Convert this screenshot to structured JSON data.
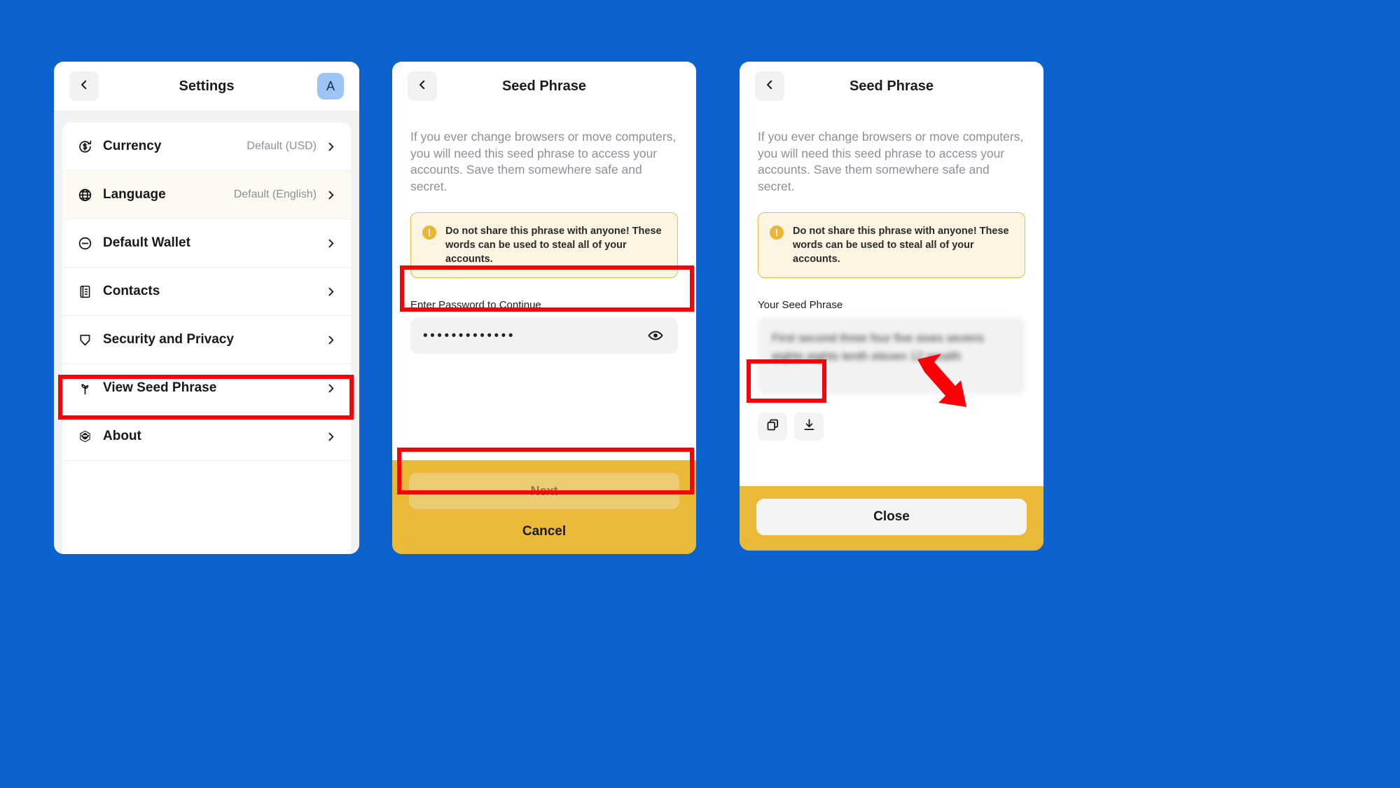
{
  "theme": {
    "background": "#0d63ce",
    "annotation": "#fb0007",
    "gold_footer": "#e9b937",
    "warning_bg": "#fdf5e2",
    "warning_border": "#e9bd4d",
    "warning_icon": "#eab63a",
    "avatar_bg": "#9cc5f5",
    "highlight_row": "#fdfaf2"
  },
  "settings_panel": {
    "title": "Settings",
    "back_icon": "chevron-left-icon",
    "avatar_initial": "A",
    "rows": [
      {
        "icon": "currency-dollar-icon",
        "label": "Currency",
        "value": "Default (USD)",
        "highlight": false
      },
      {
        "icon": "globe-icon",
        "label": "Language",
        "value": "Default (English)",
        "highlight": true
      },
      {
        "icon": "minus-circle-icon",
        "label": "Default Wallet",
        "value": "",
        "highlight": false
      },
      {
        "icon": "contacts-book-icon",
        "label": "Contacts",
        "value": "",
        "highlight": false
      },
      {
        "icon": "shield-icon",
        "label": "Security and Privacy",
        "value": "",
        "highlight": false
      },
      {
        "icon": "sprout-icon",
        "label": "View Seed Phrase",
        "value": "",
        "highlight": false
      },
      {
        "icon": "cube-icon",
        "label": "About",
        "value": "",
        "highlight": false
      }
    ]
  },
  "password_panel": {
    "title": "Seed Phrase",
    "back_icon": "chevron-left-icon",
    "description": "If you ever change browsers or move computers, you will need this seed phrase to access your accounts. Save them somewhere safe and secret.",
    "warning": {
      "icon": "exclamation-circle-icon",
      "glyph": "!",
      "text": "Do not share this phrase with anyone! These words can be used to steal all of your accounts."
    },
    "field_label": "Enter Password to Continue",
    "password_masked": "•••••••••••••",
    "reveal_icon": "eye-icon",
    "next_label": "Next",
    "next_disabled": true,
    "cancel_label": "Cancel"
  },
  "seed_panel": {
    "title": "Seed Phrase",
    "back_icon": "chevron-left-icon",
    "description": "If you ever change browsers or move computers, you will need this seed phrase to access your accounts. Save them somewhere safe and secret.",
    "warning": {
      "icon": "exclamation-circle-icon",
      "glyph": "!",
      "text": "Do not share this phrase with anyone! These words can be used to steal all of your accounts."
    },
    "seed_label": "Your Seed Phrase",
    "seed_phrase_blurred": "First second three four five sixes sevens eights eights tenth eleven 12 wealth",
    "copy_icon": "copy-icon",
    "download_icon": "download-icon",
    "close_label": "Close"
  },
  "annotations": {
    "boxes": [
      "view-seed-phrase-row",
      "password-input-field",
      "next-button",
      "seed-phrase-action-buttons"
    ],
    "arrow": "red-arrow-pointing-to-action-buttons"
  }
}
